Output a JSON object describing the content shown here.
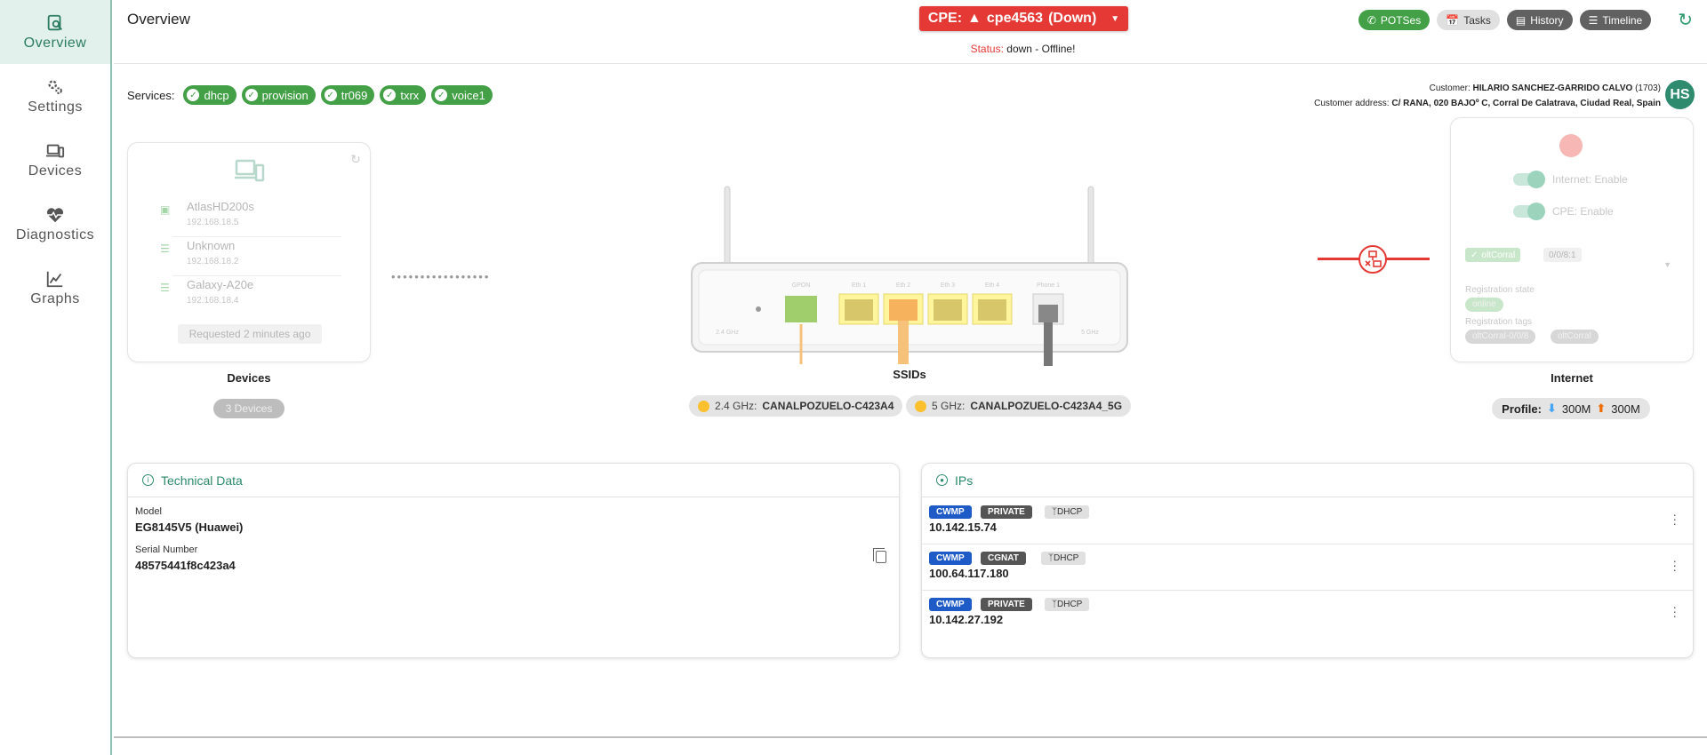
{
  "sidebar": {
    "items": [
      {
        "label": "Overview",
        "icon": "overview-icon"
      },
      {
        "label": "Settings",
        "icon": "gears-icon"
      },
      {
        "label": "Devices",
        "icon": "devices-icon"
      },
      {
        "label": "Diagnostics",
        "icon": "heartbeat-icon"
      },
      {
        "label": "Graphs",
        "icon": "graph-icon"
      }
    ],
    "active": "Overview"
  },
  "header": {
    "title": "Overview",
    "cpe_prefix": "CPE:",
    "cpe_name": "cpe4563",
    "cpe_state": "(Down)",
    "status_key": "Status:",
    "status_value": "down - Offline!",
    "actions": {
      "potses": "POTSes",
      "tasks": "Tasks",
      "history": "History",
      "timeline": "Timeline"
    }
  },
  "services": {
    "label": "Services:",
    "items": [
      "dhcp",
      "provision",
      "tr069",
      "txrx",
      "voice1"
    ]
  },
  "customer": {
    "label": "Customer:",
    "name": "HILARIO SANCHEZ-GARRIDO CALVO",
    "id": "(1703)",
    "address_label": "Customer address:",
    "address": "C/ RANA, 020 BAJOº C, Corral De Calatrava, Ciudad Real, Spain",
    "initials": "HS"
  },
  "devices_card": {
    "items": [
      {
        "name": "AtlasHD200s",
        "ip": "192.168.18.5",
        "type": "ethernet"
      },
      {
        "name": "Unknown",
        "ip": "192.168.18.2",
        "type": "wifi"
      },
      {
        "name": "Galaxy-A20e",
        "ip": "192.168.18.4",
        "type": "wifi"
      }
    ],
    "requested": "Requested 2 minutes ago",
    "title": "Devices",
    "count": "3 Devices"
  },
  "router": {
    "ports": [
      "GPON",
      "Eth 1",
      "Eth 2",
      "Eth 3",
      "Eth 4",
      "Phone 1"
    ],
    "antenna_left": "2.4 GHz",
    "antenna_right": "5 GHz"
  },
  "ssids": {
    "title": "SSIDs",
    "items": [
      {
        "band": "2.4 GHz:",
        "name": "CANALPOZUELO-C423A4"
      },
      {
        "band": "5 GHz:",
        "name": "CANALPOZUELO-C423A4_5G"
      }
    ]
  },
  "internet_card": {
    "internet_toggle": "Internet: Enable",
    "cpe_toggle": "CPE: Enable",
    "olt": "oltCorral",
    "olt_port": "0/0/8:1",
    "reg_state_label": "Registration state",
    "reg_state": "online",
    "reg_tags_label": "Registration tags",
    "reg_tags": [
      "oltCorral-0/0/8",
      "oltCorral"
    ],
    "title": "Internet",
    "profile_label": "Profile:",
    "down": "300M",
    "up": "300M"
  },
  "technical": {
    "title": "Technical Data",
    "model_label": "Model",
    "model": "EG8145V5 (Huawei)",
    "serial_label": "Serial Number",
    "serial": "48575441f8c423a4"
  },
  "ips": {
    "title": "IPs",
    "rows": [
      {
        "tags": [
          "CWMP",
          "PRIVATE",
          "DHCP"
        ],
        "ip": "10.142.15.74"
      },
      {
        "tags": [
          "CWMP",
          "CGNAT",
          "DHCP"
        ],
        "ip": "100.64.117.180"
      },
      {
        "tags": [
          "CWMP",
          "PRIVATE",
          "DHCP"
        ],
        "ip": "10.142.27.192"
      }
    ]
  },
  "colors": {
    "accent": "#2b8a68",
    "down": "#e53935",
    "ok": "#43a047"
  }
}
